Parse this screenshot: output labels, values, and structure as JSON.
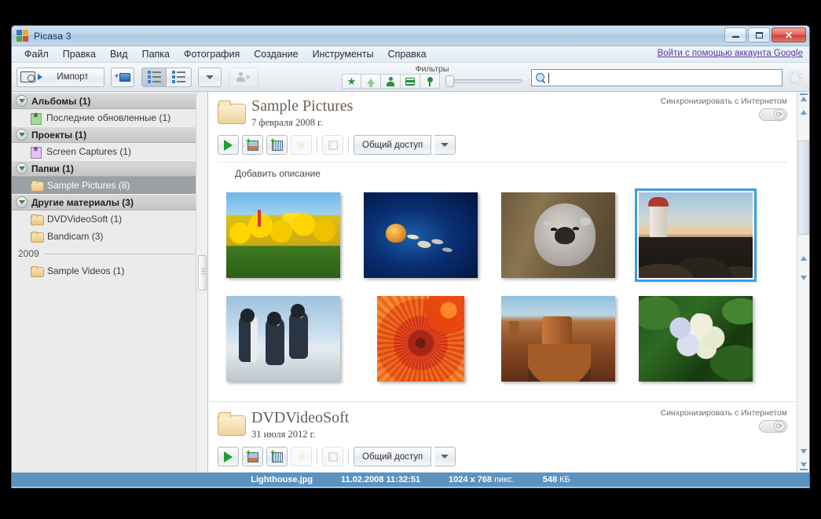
{
  "window": {
    "title": "Picasa 3",
    "app_icon": "picasa-logo-icon",
    "buttons": {
      "minimize": "minimize-icon",
      "maximize": "maximize-icon",
      "close": "close-icon"
    }
  },
  "menubar": {
    "items": [
      "Файл",
      "Правка",
      "Вид",
      "Папка",
      "Фотография",
      "Создание",
      "Инструменты",
      "Справка"
    ],
    "google_link": "Войти с помощью аккаунта Google"
  },
  "toolbar": {
    "import_label": "Импорт",
    "add_folder_icon": "add-folder-icon",
    "view_list_icon": "list-view-icon",
    "view_detail_icon": "detail-view-icon",
    "dropdown_icon": "chevron-down-icon",
    "people_icon": "people-icon",
    "filters_label": "Фильтры",
    "filters": [
      "star-filter-icon",
      "upload-filter-icon",
      "faces-filter-icon",
      "video-filter-icon",
      "geotag-filter-icon"
    ],
    "zoom_value": 0,
    "search_placeholder": "",
    "search_value": "",
    "search_icon": "search-icon",
    "spinner_icon": "spinner-icon"
  },
  "sidebar": {
    "groups": [
      {
        "label": "Альбомы (1)",
        "twisty": "collapse-triangle-icon",
        "items": [
          {
            "label": "Последние обновленные (1)",
            "icon": "album-green-icon",
            "selected": false
          }
        ]
      },
      {
        "label": "Проекты (1)",
        "twisty": "collapse-triangle-icon",
        "items": [
          {
            "label": "Screen Captures (1)",
            "icon": "album-violet-icon",
            "selected": false
          }
        ]
      },
      {
        "label": "Папки (1)",
        "twisty": "collapse-triangle-icon",
        "items": [
          {
            "label": "Sample Pictures (8)",
            "icon": "folder-icon",
            "selected": true
          }
        ]
      },
      {
        "label": "Другие материалы (3)",
        "twisty": "collapse-triangle-icon",
        "items": [
          {
            "label": "DVDVideoSoft (1)",
            "icon": "folder-icon",
            "selected": false
          },
          {
            "label": "Bandicam (3)",
            "icon": "folder-icon",
            "selected": false
          }
        ]
      }
    ],
    "year_divider": "2009",
    "year_items": [
      {
        "label": "Sample Videos (1)",
        "icon": "folder-icon",
        "selected": false
      }
    ]
  },
  "albums": [
    {
      "name": "Sample Pictures",
      "date": "7 февраля 2008 г.",
      "folder_icon": "folder-large-icon",
      "sync_label": "Синхронизировать с Интернетом",
      "sync_toggle_icon": "sync-toggle-icon",
      "sync_on": false,
      "description_placeholder": "Добавить описание",
      "actions": {
        "play": "play-slideshow-icon",
        "add_photo": "add-photo-icon",
        "add_video": "add-video-icon",
        "star": "star-icon",
        "save": "save-disk-icon",
        "share_label": "Общий доступ",
        "share_caret": "chevron-down-icon"
      },
      "thumbnails": [
        {
          "name": "Tulips",
          "art": "t-tulips",
          "shape": "wide",
          "selected": false
        },
        {
          "name": "Jellyfish",
          "art": "t-jelly",
          "shape": "wide",
          "selected": false
        },
        {
          "name": "Koala",
          "art": "t-koala",
          "shape": "wide",
          "selected": false
        },
        {
          "name": "Lighthouse",
          "art": "t-lh",
          "shape": "wide",
          "selected": true
        },
        {
          "name": "Penguins",
          "art": "t-peng",
          "shape": "wide",
          "selected": false
        },
        {
          "name": "Chrysanthemum",
          "art": "t-chrys",
          "shape": "square",
          "selected": false
        },
        {
          "name": "Desert",
          "art": "t-desert",
          "shape": "wide",
          "selected": false
        },
        {
          "name": "Hydrangeas",
          "art": "t-hyd",
          "shape": "wide",
          "selected": false
        }
      ]
    },
    {
      "name": "DVDVideoSoft",
      "date": "31 июля 2012 г.",
      "folder_icon": "folder-large-icon",
      "sync_label": "Синхронизировать с Интернетом",
      "sync_toggle_icon": "sync-toggle-icon",
      "sync_on": false,
      "actions": {
        "play": "play-slideshow-icon",
        "add_photo": "add-photo-icon",
        "add_video": "add-video-icon",
        "star": "star-icon",
        "save": "save-disk-icon",
        "share_label": "Общий доступ",
        "share_caret": "chevron-down-icon"
      }
    }
  ],
  "statusbar": {
    "filename": "Lighthouse.jpg",
    "datetime": "11.02.2008 11:32:51",
    "dimensions": "1024 x 768",
    "dimensions_unit": "пикс.",
    "filesize": "548",
    "filesize_unit": "КБ"
  },
  "colors": {
    "status_bar": "#5b93c0",
    "selection": "#3d9ce0",
    "link": "#5b3a9e",
    "accent_green": "#2e8b3f"
  }
}
